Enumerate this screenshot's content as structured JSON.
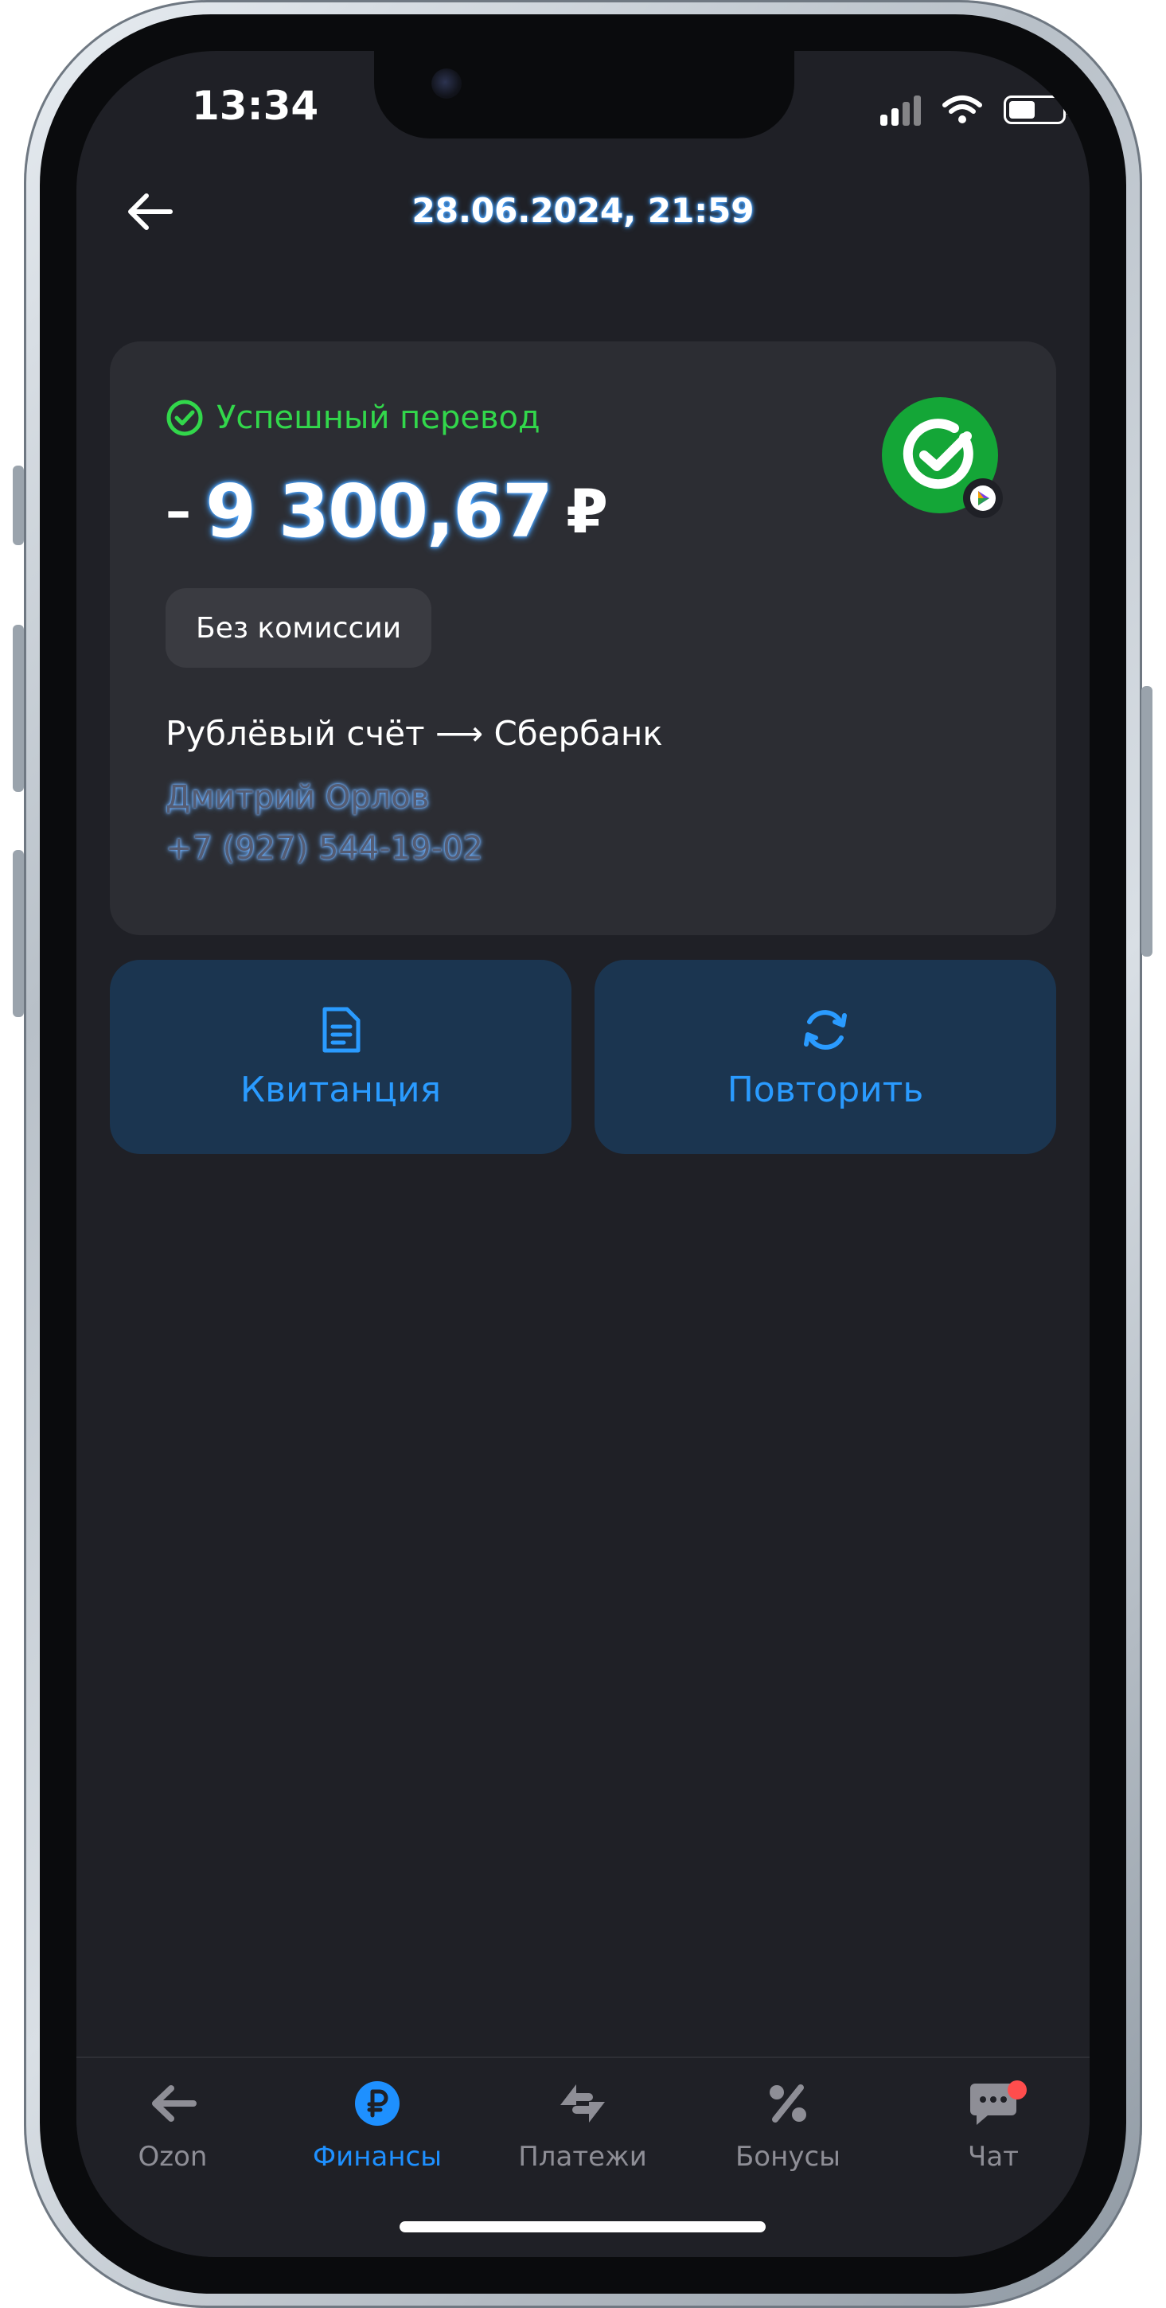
{
  "status_bar": {
    "time": "13:34"
  },
  "header": {
    "title": "28.06.2024, 21:59"
  },
  "transfer": {
    "status": "Успешный перевод",
    "amount_sign": "–",
    "amount": "9 300,67",
    "currency": "₽",
    "fee": "Без комиссии",
    "route": "Рублёвый счёт ⟶ Сбербанк",
    "recipient_name": "Дмитрий Орлов",
    "recipient_phone": "+7 (927) 544-19-02",
    "bank_logo_icon": "sberbank-logo-icon"
  },
  "actions": {
    "receipt_label": "Квитанция",
    "repeat_label": "Повторить"
  },
  "tabbar": {
    "items": [
      {
        "label": "Ozon",
        "icon": "arrow-left-icon",
        "active": false
      },
      {
        "label": "Финансы",
        "icon": "ruble-coin-icon",
        "active": true
      },
      {
        "label": "Платежи",
        "icon": "swap-arrows-icon",
        "active": false
      },
      {
        "label": "Бонусы",
        "icon": "percent-icon",
        "active": false
      },
      {
        "label": "Чат",
        "icon": "chat-bubble-icon",
        "active": false,
        "badge": true
      }
    ]
  },
  "colors": {
    "accent": "#1e90ff",
    "success": "#32d74b",
    "background": "#1f2026",
    "card": "#2c2d33",
    "button": "#1b3550"
  }
}
